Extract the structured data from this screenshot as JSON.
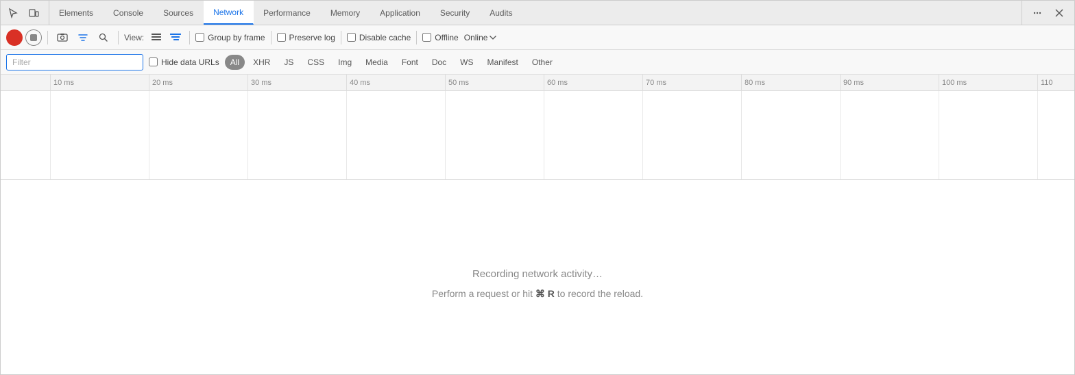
{
  "tabs": {
    "items": [
      {
        "id": "elements",
        "label": "Elements",
        "active": false
      },
      {
        "id": "console",
        "label": "Console",
        "active": false
      },
      {
        "id": "sources",
        "label": "Sources",
        "active": false
      },
      {
        "id": "network",
        "label": "Network",
        "active": true
      },
      {
        "id": "performance",
        "label": "Performance",
        "active": false
      },
      {
        "id": "memory",
        "label": "Memory",
        "active": false
      },
      {
        "id": "application",
        "label": "Application",
        "active": false
      },
      {
        "id": "security",
        "label": "Security",
        "active": false
      },
      {
        "id": "audits",
        "label": "Audits",
        "active": false
      }
    ]
  },
  "toolbar": {
    "view_label": "View:",
    "group_by_frame_label": "Group by frame",
    "preserve_log_label": "Preserve log",
    "disable_cache_label": "Disable cache",
    "offline_label": "Offline",
    "online_label": "Online"
  },
  "filter": {
    "placeholder": "Filter",
    "hide_data_urls_label": "Hide data URLs",
    "pills": [
      {
        "label": "All",
        "active": true
      },
      {
        "label": "XHR",
        "active": false
      },
      {
        "label": "JS",
        "active": false
      },
      {
        "label": "CSS",
        "active": false
      },
      {
        "label": "Img",
        "active": false
      },
      {
        "label": "Media",
        "active": false
      },
      {
        "label": "Font",
        "active": false
      },
      {
        "label": "Doc",
        "active": false
      },
      {
        "label": "WS",
        "active": false
      },
      {
        "label": "Manifest",
        "active": false
      },
      {
        "label": "Other",
        "active": false
      }
    ]
  },
  "timeline": {
    "ticks": [
      {
        "label": "10 ms",
        "position": 72
      },
      {
        "label": "20 ms",
        "position": 216
      },
      {
        "label": "30 ms",
        "position": 360
      },
      {
        "label": "40 ms",
        "position": 504
      },
      {
        "label": "50 ms",
        "position": 648
      },
      {
        "label": "60 ms",
        "position": 792
      },
      {
        "label": "70 ms",
        "position": 936
      },
      {
        "label": "80 ms",
        "position": 1080
      },
      {
        "label": "90 ms",
        "position": 1224
      },
      {
        "label": "100 ms",
        "position": 1368
      },
      {
        "label": "110",
        "position": 1512
      }
    ]
  },
  "empty_state": {
    "primary": "Recording network activity…",
    "secondary_prefix": "Perform a request or hit ",
    "secondary_key": "⌘ R",
    "secondary_suffix": " to record the reload."
  }
}
